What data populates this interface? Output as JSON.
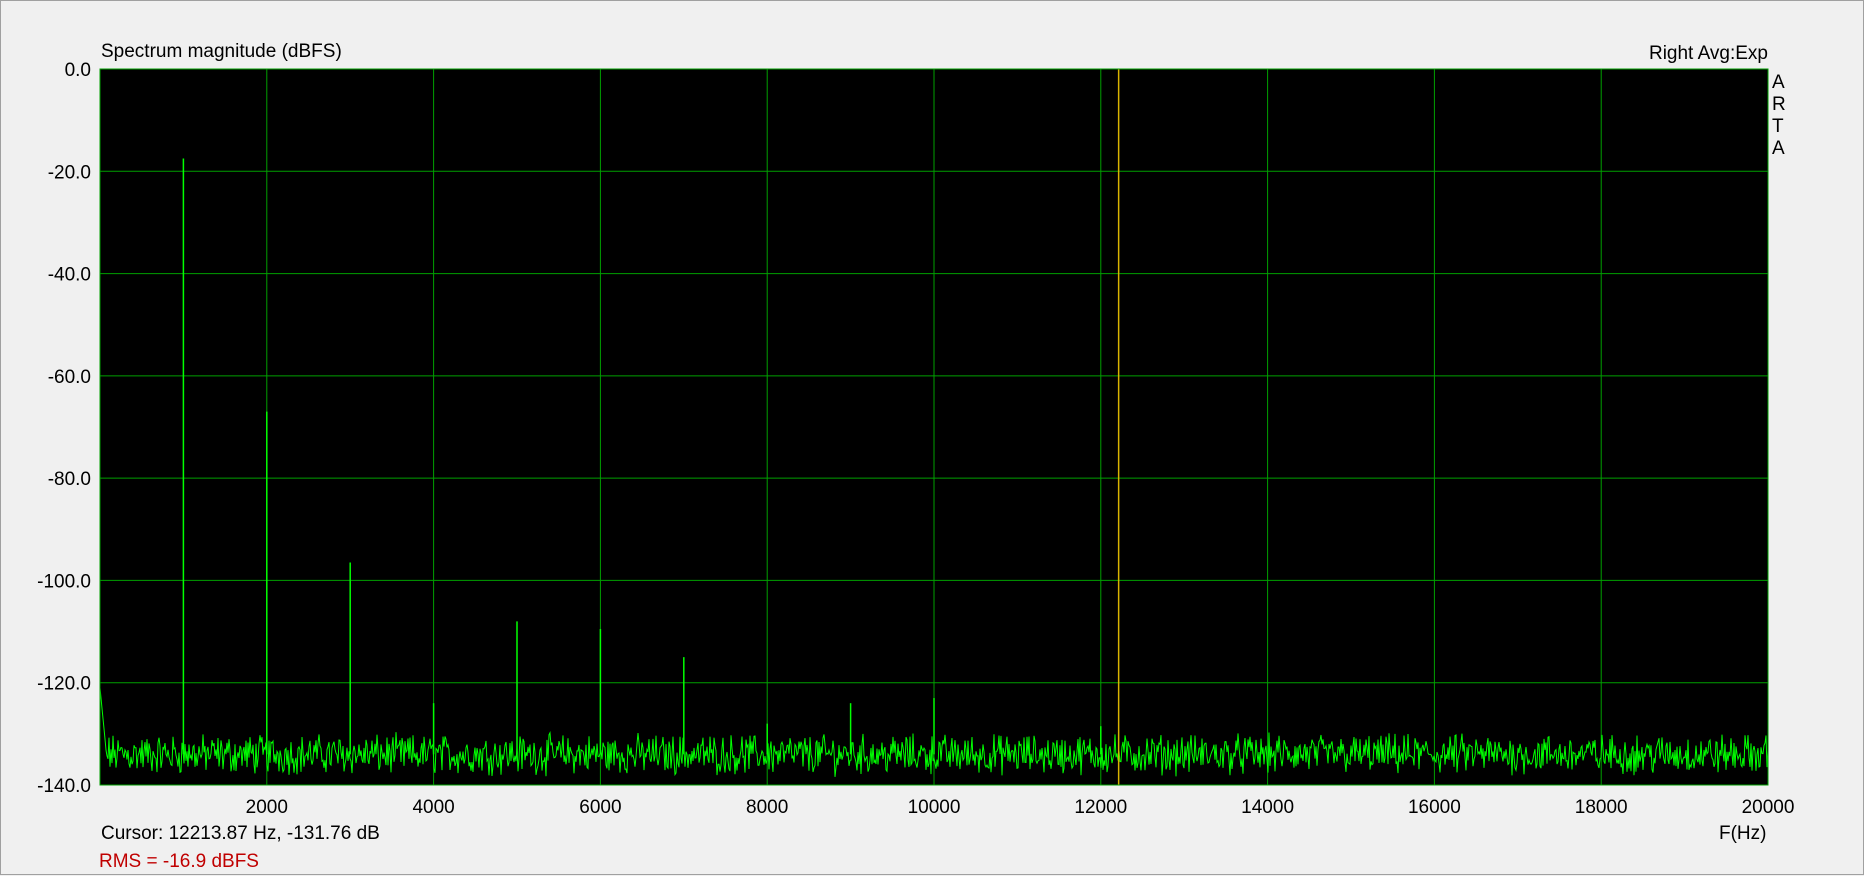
{
  "chart_data": {
    "type": "line",
    "title": "Spectrum magnitude (dBFS)",
    "mode_label": "Right Avg:Exp",
    "brand_letters": [
      "A",
      "R",
      "T",
      "A"
    ],
    "xlabel": "F(Hz)",
    "ylabel": "",
    "xlim": [
      0,
      20000
    ],
    "ylim": [
      -140,
      0
    ],
    "x_ticks": [
      2000,
      4000,
      6000,
      8000,
      10000,
      12000,
      14000,
      16000,
      18000,
      20000
    ],
    "y_ticks": [
      0,
      -20,
      -40,
      -60,
      -80,
      -100,
      -120,
      -140
    ],
    "x_tick_labels": [
      "2000",
      "4000",
      "6000",
      "8000",
      "10000",
      "12000",
      "14000",
      "16000",
      "18000",
      "20000"
    ],
    "y_tick_labels": [
      "0.0",
      "-20.0",
      "-40.0",
      "-60.0",
      "-80.0",
      "-100.0",
      "-120.0",
      "-140.0"
    ],
    "grid": true,
    "noise_floor_db": -134,
    "peaks": [
      {
        "x": 1000,
        "y": -17.5
      },
      {
        "x": 2000,
        "y": -67
      },
      {
        "x": 3000,
        "y": -96.5
      },
      {
        "x": 4000,
        "y": -124
      },
      {
        "x": 5000,
        "y": -108
      },
      {
        "x": 6000,
        "y": -109.5
      },
      {
        "x": 7000,
        "y": -115
      },
      {
        "x": 8000,
        "y": -128
      },
      {
        "x": 9000,
        "y": -124
      },
      {
        "x": 10000,
        "y": -123
      },
      {
        "x": 12000,
        "y": -128.5
      }
    ],
    "cursor_x": 12213.87,
    "cursor_readout": "Cursor: 12213.87 Hz, -131.76 dB",
    "rms_readout": "RMS =  -16.9 dBFS",
    "colors": {
      "plot_bg": "#000000",
      "grid": "#00a000",
      "trace": "#00ff00",
      "cursor": "#d8b400",
      "rms_text": "#c00000"
    }
  }
}
